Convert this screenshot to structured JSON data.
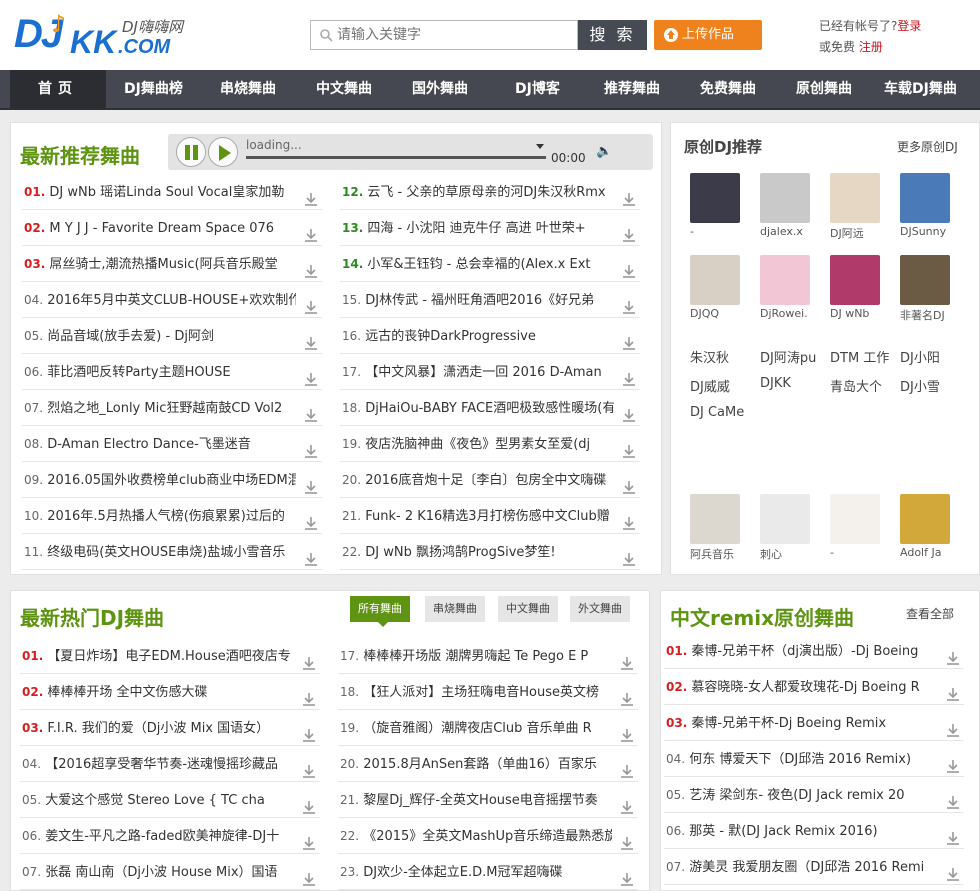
{
  "logo": {
    "dj": "DJ",
    "kk": "KK",
    "cn": "DJ嗨嗨网",
    "com": ".COM"
  },
  "search": {
    "placeholder": "请输入关键字",
    "button": "搜 索"
  },
  "upload": {
    "label": "上传作品"
  },
  "account": {
    "has_account": "已经有帐号了?",
    "login": "登录",
    "or_free": "或免费",
    "register": "注册"
  },
  "nav": [
    "首页",
    "DJ舞曲榜",
    "串烧舞曲",
    "中文舞曲",
    "国外舞曲",
    "DJ博客",
    "推荐舞曲",
    "免费舞曲",
    "原创舞曲",
    "车载DJ舞曲"
  ],
  "recommend": {
    "title": "最新推荐舞曲",
    "player": {
      "loading": "loading...",
      "time": "00:00"
    },
    "left": [
      {
        "n": "01.",
        "t": "DJ wNb 瑶诺Linda Soul Vocal皇家加勒"
      },
      {
        "n": "02.",
        "t": "M Y J J - Favorite Dream Space 076"
      },
      {
        "n": "03.",
        "t": "屌丝骑士,潮流热播Music(阿兵音乐殿堂"
      },
      {
        "n": "04.",
        "t": "2016年5月中英文CLUB-HOUSE+欢欢制作"
      },
      {
        "n": "05.",
        "t": "尚品音域(放手去爱) - Dj阿剑"
      },
      {
        "n": "06.",
        "t": "菲比酒吧反转Party主题HOUSE"
      },
      {
        "n": "07.",
        "t": "烈焰之地_Lonly Mic狂野越南鼓CD Vol2"
      },
      {
        "n": "08.",
        "t": "D-Aman Electro Dance-飞墨迷音"
      },
      {
        "n": "09.",
        "t": "2016.05国外收费榜单club商业中场EDM混"
      },
      {
        "n": "10.",
        "t": "2016年.5月热播人气榜(伤痕累累)过后的"
      },
      {
        "n": "11.",
        "t": "终级电码(英文HOUSE串烧)盐城小雪音乐"
      }
    ],
    "right": [
      {
        "n": "12.",
        "t": "云飞 - 父亲的草原母亲的河DJ朱汉秋Rmx"
      },
      {
        "n": "13.",
        "t": "四海 - 小沈阳 迪克牛仔 高进 叶世荣+"
      },
      {
        "n": "14.",
        "t": "小军&王钰钧 - 总会幸福的(Alex.x Ext"
      },
      {
        "n": "15.",
        "t": "DJ林传武 - 福州旺角酒吧2016《好兄弟"
      },
      {
        "n": "16.",
        "t": "远古的丧钟DarkProgressive"
      },
      {
        "n": "17.",
        "t": "【中文风暴】潇洒走一回 2016 D-Aman"
      },
      {
        "n": "18.",
        "t": "DjHaiOu-BABY FACE酒吧极致感性暖场(有"
      },
      {
        "n": "19.",
        "t": "夜店洗脑神曲《夜色》型男素女至爱(dj"
      },
      {
        "n": "20.",
        "t": "2016底音炮十足〔李白〕包房全中文嗨碟"
      },
      {
        "n": "21.",
        "t": "Funk- 2 K16精选3月打榜伤感中文Club赠"
      },
      {
        "n": "22.",
        "t": "DJ wNb 飘扬鸿鹄ProgSive梦笙!"
      }
    ]
  },
  "original_dj": {
    "title": "原创DJ推荐",
    "more": "更多原创DJ",
    "row1": [
      "-",
      "djalex.x",
      "DJ阿远",
      "DJSunny"
    ],
    "row2": [
      "DJQQ",
      "DjRowei.",
      "DJ wNb",
      "非著名DJ"
    ],
    "names": [
      "朱汉秋",
      "DJ阿涛pu",
      "DTM 工作",
      "DJ小阳",
      "DJ威威",
      "DJKK",
      "青岛大个",
      "DJ小雪",
      "DJ CaMe"
    ],
    "row3": [
      "阿兵音乐",
      "刺心",
      "-",
      "Adolf Ja"
    ]
  },
  "hot": {
    "title": "最新热门DJ舞曲",
    "tabs": [
      "所有舞曲",
      "串烧舞曲",
      "中文舞曲",
      "外文舞曲"
    ],
    "left": [
      {
        "n": "01.",
        "t": "【夏日炸场】电子EDM.House酒吧夜店专"
      },
      {
        "n": "02.",
        "t": "棒棒棒开场 全中文伤感大碟"
      },
      {
        "n": "03.",
        "t": "F.I.R. 我们的爱（Dj小波 Mix 国语女）"
      },
      {
        "n": "04.",
        "t": "【2016超享受奢华节奏-迷魂慢摇珍藏品"
      },
      {
        "n": "05.",
        "t": "大爱这个感觉 Stereo Love { TC cha"
      },
      {
        "n": "06.",
        "t": "姜文生-平凡之路-faded欧美神旋律-DJ十"
      },
      {
        "n": "07.",
        "t": "张磊 南山南（Dj小波 House Mix）国语"
      }
    ],
    "right": [
      {
        "n": "17.",
        "t": "棒棒棒开场版 潮牌男嗨起 Te Pego E P"
      },
      {
        "n": "18.",
        "t": "【狂人派对】主场狂嗨电音House英文榜"
      },
      {
        "n": "19.",
        "t": "（旋音雅阁）潮牌夜店Club 音乐单曲 R"
      },
      {
        "n": "20.",
        "t": "2015.8月AnSen套路（单曲16）百家乐"
      },
      {
        "n": "21.",
        "t": "黎屋Dj_辉仔-全英文House电音摇摆节奏"
      },
      {
        "n": "22.",
        "t": "《2015》全英文MashUp音乐缔造最熟悉旋"
      },
      {
        "n": "23.",
        "t": "DJ欢少-全体起立E.D.M冠军超嗨碟"
      }
    ]
  },
  "remix": {
    "title": "中文remix原创舞曲",
    "more": "查看全部",
    "items": [
      {
        "n": "01.",
        "t": "秦博-兄弟干杯（dj演出版）-Dj Boeing"
      },
      {
        "n": "02.",
        "t": "慕容晓晓-女人都爱玫瑰花-Dj Boeing R"
      },
      {
        "n": "03.",
        "t": "秦博-兄弟干杯-Dj Boeing Remix"
      },
      {
        "n": "04.",
        "t": "何东 博爱天下（DJ邱浩 2016 Remix)"
      },
      {
        "n": "05.",
        "t": "艺涛 梁剑东- 夜色(DJ Jack remix 20"
      },
      {
        "n": "06.",
        "t": "那英 - 默(DJ Jack Remix 2016)"
      },
      {
        "n": "07.",
        "t": "游美灵 我爱朋友圈（DJ邱浩 2016 Remi"
      }
    ]
  },
  "colors": {
    "green": "#5e9411",
    "red": "#d71e1e",
    "navbg": "#454850",
    "orange": "#f0821e"
  }
}
